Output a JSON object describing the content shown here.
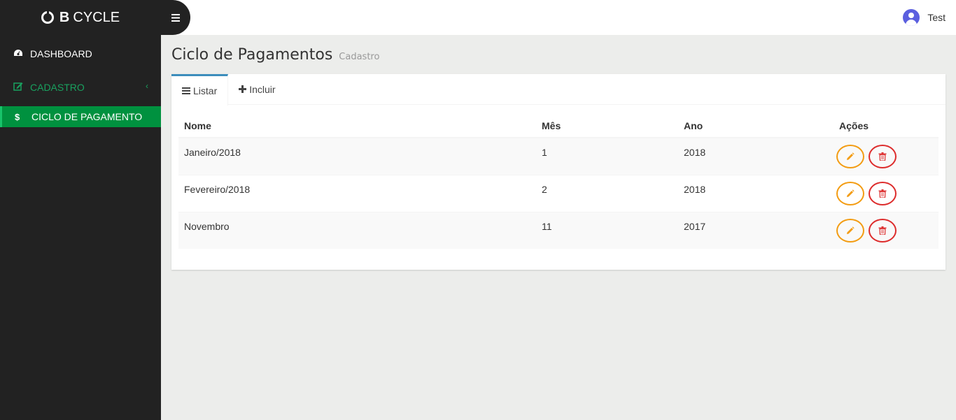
{
  "brand": {
    "bold": "B",
    "name": "CYCLE"
  },
  "header": {
    "user_name": "Test"
  },
  "sidebar": {
    "items": [
      {
        "label": "DASHBOARD",
        "icon": "dashboard-icon"
      },
      {
        "label": "CADASTRO",
        "icon": "edit-icon"
      },
      {
        "label": "CICLO DE PAGAMENTO",
        "icon": "dollar-icon"
      }
    ]
  },
  "page": {
    "title": "Ciclo de Pagamentos",
    "subtitle": "Cadastro"
  },
  "tabs": [
    {
      "label": "Listar",
      "icon": "list-icon"
    },
    {
      "label": "Incluir",
      "icon": "plus-icon"
    }
  ],
  "table": {
    "headers": [
      "Nome",
      "Mês",
      "Ano",
      "Ações"
    ],
    "rows": [
      [
        "Janeiro/2018",
        "1",
        "2018"
      ],
      [
        "Fevereiro/2018",
        "2",
        "2018"
      ],
      [
        "Novembro",
        "11",
        "2017"
      ]
    ]
  },
  "colors": {
    "sidebar": "#222222",
    "active": "#00913f",
    "accent_green": "#19a15f",
    "edit": "#f39c12",
    "delete": "#dd2c2c",
    "tab_active": "#3c8dbc"
  }
}
